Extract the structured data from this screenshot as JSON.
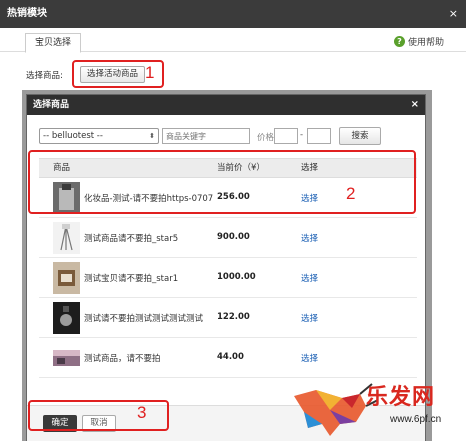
{
  "window": {
    "title": "热销模块",
    "close": "×"
  },
  "tabs": [
    {
      "label": "宝贝选择"
    }
  ],
  "help": {
    "label": "使用帮助",
    "icon": "question-icon"
  },
  "selector": {
    "label": "选择商品:",
    "button": "选择活动商品"
  },
  "annotations": [
    "1",
    "2",
    "3"
  ],
  "modal": {
    "title": "选择商品",
    "close": "×",
    "shop_select": "-- belluotest --",
    "keyword_placeholder": "商品关键字",
    "price_label": "价格",
    "price_dash": "-",
    "search_button": "搜索",
    "columns": {
      "product": "商品",
      "price": "当前价（¥）",
      "select": "选择"
    },
    "rows": [
      {
        "name": "化妆品-测试-请不要拍https-0707",
        "price": "256.00",
        "action": "选择"
      },
      {
        "name": "测试商品请不要拍_star5",
        "price": "900.00",
        "action": "选择"
      },
      {
        "name": "测试宝贝请不要拍_star1",
        "price": "1000.00",
        "action": "选择"
      },
      {
        "name": "测试请不要拍测试测试测试测试",
        "price": "122.00",
        "action": "选择"
      },
      {
        "name": "测试商品，请不要拍",
        "price": "44.00",
        "action": "选择"
      }
    ],
    "ok_button": "确定",
    "cancel_button": "取消"
  },
  "watermark": {
    "text": "乐发网",
    "url": "www.6pf.cn"
  },
  "colors": {
    "annotation": "#e02020",
    "link": "#1a5fb4",
    "title_bar": "#3b3b3b"
  }
}
